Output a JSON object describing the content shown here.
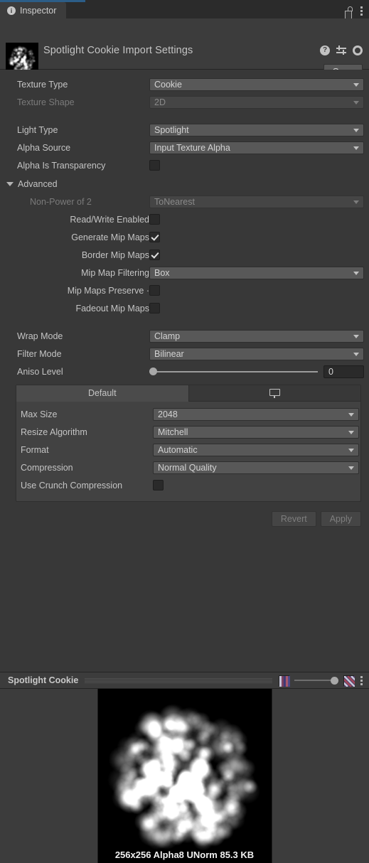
{
  "window": {
    "tab_label": "Inspector",
    "tab_icon": "info-icon",
    "lock_icon": "lock-open-icon",
    "menu_icon": "kebab-menu-icon",
    "accent_color": "#2c5d87"
  },
  "header": {
    "title": "Spotlight Cookie Import Settings",
    "thumbnail_name": "texture-thumbnail",
    "help_icon": "help-icon",
    "preset_icon": "preset-icon",
    "settings_icon": "gear-icon",
    "open_label": "Open"
  },
  "settings": {
    "texture_type": {
      "label": "Texture Type",
      "value": "Cookie",
      "disabled": false
    },
    "texture_shape": {
      "label": "Texture Shape",
      "value": "2D",
      "disabled": true
    },
    "light_type": {
      "label": "Light Type",
      "value": "Spotlight",
      "disabled": false
    },
    "alpha_source": {
      "label": "Alpha Source",
      "value": "Input Texture Alpha",
      "disabled": false
    },
    "alpha_is_transparency": {
      "label": "Alpha Is Transparency",
      "checked": false
    }
  },
  "advanced": {
    "label": "Advanced",
    "expanded": true,
    "non_power_of_2": {
      "label": "Non-Power of 2",
      "value": "ToNearest",
      "disabled": true
    },
    "read_write_enabled": {
      "label": "Read/Write Enabled",
      "checked": false
    },
    "generate_mip_maps": {
      "label": "Generate Mip Maps",
      "checked": true
    },
    "border_mip_maps": {
      "label": "Border Mip Maps",
      "checked": true
    },
    "mip_map_filtering": {
      "label": "Mip Map Filtering",
      "value": "Box",
      "disabled": false
    },
    "mip_maps_preserve": {
      "label": "Mip Maps Preserve ·",
      "checked": false
    },
    "fadeout_mip_maps": {
      "label": "Fadeout Mip Maps",
      "checked": false
    }
  },
  "sampling": {
    "wrap_mode": {
      "label": "Wrap Mode",
      "value": "Clamp"
    },
    "filter_mode": {
      "label": "Filter Mode",
      "value": "Bilinear"
    },
    "aniso_level": {
      "label": "Aniso Level",
      "value": "0",
      "slider_percent": 0
    }
  },
  "platform": {
    "tabs": [
      {
        "label": "Default",
        "active": true,
        "icon": null
      },
      {
        "label": "",
        "active": false,
        "icon": "monitor-icon"
      }
    ],
    "max_size": {
      "label": "Max Size",
      "value": "2048"
    },
    "resize_algorithm": {
      "label": "Resize Algorithm",
      "value": "Mitchell"
    },
    "format": {
      "label": "Format",
      "value": "Automatic"
    },
    "compression": {
      "label": "Compression",
      "value": "Normal Quality"
    },
    "use_crunch_compression": {
      "label": "Use Crunch Compression",
      "checked": false
    }
  },
  "actions": {
    "revert_label": "Revert",
    "apply_label": "Apply",
    "disabled": true
  },
  "preview": {
    "title": "Spotlight Cookie",
    "checker_icon": "checkerboard-icon",
    "stripe_icon": "diagonal-stripe-icon",
    "menu_icon": "kebab-menu-icon",
    "zoom_percent": 100,
    "info": "256x256  Alpha8 UNorm   85.3 KB",
    "resolution": "256x256",
    "format": "Alpha8 UNorm",
    "size": "85.3 KB"
  }
}
